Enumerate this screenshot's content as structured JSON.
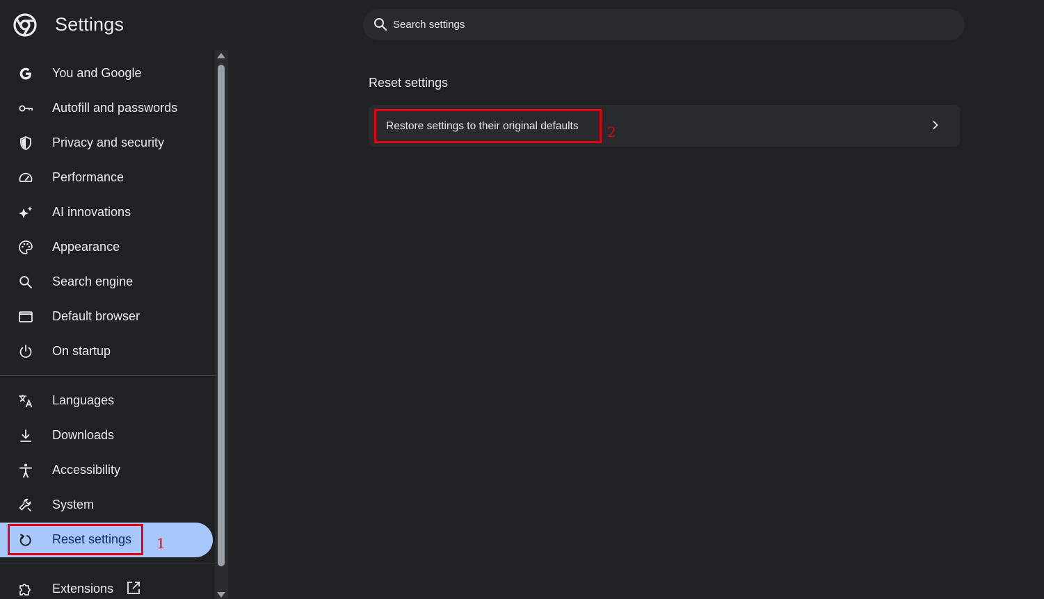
{
  "header": {
    "title": "Settings",
    "logo_icon": "chrome-logo-icon",
    "search_placeholder": "Search settings"
  },
  "sidebar": {
    "items": [
      {
        "label": "You and Google",
        "icon": "google-g-icon"
      },
      {
        "label": "Autofill and passwords",
        "icon": "key-icon"
      },
      {
        "label": "Privacy and security",
        "icon": "shield-icon"
      },
      {
        "label": "Performance",
        "icon": "speedometer-icon"
      },
      {
        "label": "AI innovations",
        "icon": "sparkle-icon"
      },
      {
        "label": "Appearance",
        "icon": "palette-icon"
      },
      {
        "label": "Search engine",
        "icon": "search-icon"
      },
      {
        "label": "Default browser",
        "icon": "browser-window-icon"
      },
      {
        "label": "On startup",
        "icon": "power-icon"
      },
      {
        "label": "Languages",
        "icon": "translate-icon"
      },
      {
        "label": "Downloads",
        "icon": "download-icon"
      },
      {
        "label": "Accessibility",
        "icon": "accessibility-icon"
      },
      {
        "label": "System",
        "icon": "wrench-icon"
      },
      {
        "label": "Reset settings",
        "icon": "reset-icon",
        "active": true
      },
      {
        "label": "Extensions",
        "icon": "puzzle-icon",
        "external": true
      }
    ]
  },
  "main": {
    "section_title": "Reset settings",
    "rows": [
      {
        "label": "Restore settings to their original defaults",
        "icon": "chevron-right-icon"
      }
    ]
  },
  "annotations": [
    {
      "number": "1",
      "target": "Reset settings"
    },
    {
      "number": "2",
      "target": "Restore settings to their original defaults"
    }
  ],
  "colors": {
    "background": "#202124",
    "surface": "#292a2d",
    "active_item": "#a8c7fa",
    "annotation": "#e3000f"
  }
}
